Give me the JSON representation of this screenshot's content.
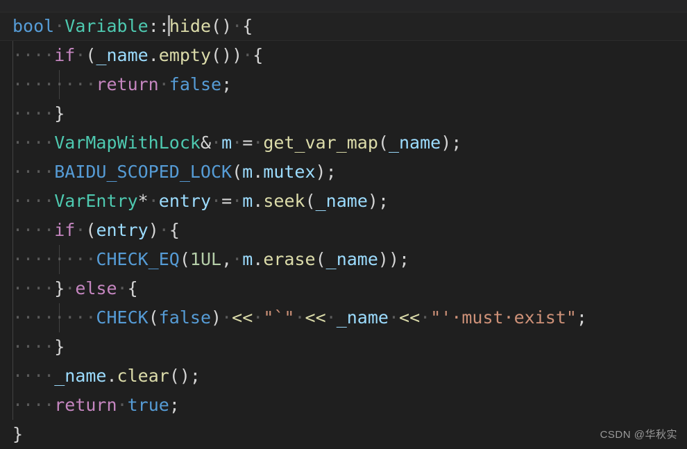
{
  "editor": {
    "language": "cpp",
    "theme": "dark-plus",
    "colors": {
      "background": "#1f1f1f",
      "active_line": "#222222",
      "foreground": "#d4d4d4",
      "keyword": "#569cd6",
      "control": "#c586c0",
      "type": "#4ec9b0",
      "function": "#dcdcaa",
      "variable": "#9cdcfe",
      "number": "#b5cea8",
      "string": "#ce9178",
      "indent_guide": "#606060",
      "whitespace_dot": "#5a5a5a",
      "cursor": "#a8a8a8"
    },
    "cursor": {
      "line": 1,
      "after_text": "bool Variable::"
    }
  },
  "code": {
    "lines": [
      {
        "active": true,
        "guides": 0,
        "tokens": [
          {
            "text": "bool",
            "cls": "t-keyword"
          },
          {
            "text": "·",
            "cls": "ws"
          },
          {
            "text": "Variable",
            "cls": "t-type"
          },
          {
            "text": "::",
            "cls": "t-operator"
          },
          {
            "text": "",
            "cls": "cursor-marker"
          },
          {
            "text": "hide",
            "cls": "t-func"
          },
          {
            "text": "()",
            "cls": "t-punct"
          },
          {
            "text": "·",
            "cls": "ws"
          },
          {
            "text": "{",
            "cls": "t-punct"
          }
        ]
      },
      {
        "active": false,
        "guides": 1,
        "tokens": [
          {
            "text": "····",
            "cls": "ws"
          },
          {
            "text": "if",
            "cls": "t-control"
          },
          {
            "text": "·",
            "cls": "ws"
          },
          {
            "text": "(",
            "cls": "t-punct"
          },
          {
            "text": "_name",
            "cls": "t-var"
          },
          {
            "text": ".",
            "cls": "t-operator"
          },
          {
            "text": "empty",
            "cls": "t-func"
          },
          {
            "text": "())",
            "cls": "t-punct"
          },
          {
            "text": "·",
            "cls": "ws"
          },
          {
            "text": "{",
            "cls": "t-punct"
          }
        ]
      },
      {
        "active": false,
        "guides": 2,
        "tokens": [
          {
            "text": "········",
            "cls": "ws"
          },
          {
            "text": "return",
            "cls": "t-control"
          },
          {
            "text": "·",
            "cls": "ws"
          },
          {
            "text": "false",
            "cls": "t-const"
          },
          {
            "text": ";",
            "cls": "t-operator"
          }
        ]
      },
      {
        "active": false,
        "guides": 1,
        "tokens": [
          {
            "text": "····",
            "cls": "ws"
          },
          {
            "text": "}",
            "cls": "t-punct"
          }
        ]
      },
      {
        "active": false,
        "guides": 1,
        "tokens": [
          {
            "text": "····",
            "cls": "ws"
          },
          {
            "text": "VarMapWithLock",
            "cls": "t-type"
          },
          {
            "text": "&",
            "cls": "t-operator"
          },
          {
            "text": "·",
            "cls": "ws"
          },
          {
            "text": "m",
            "cls": "t-var"
          },
          {
            "text": "·",
            "cls": "ws"
          },
          {
            "text": "=",
            "cls": "t-operator"
          },
          {
            "text": "·",
            "cls": "ws"
          },
          {
            "text": "get_var_map",
            "cls": "t-func"
          },
          {
            "text": "(",
            "cls": "t-punct"
          },
          {
            "text": "_name",
            "cls": "t-var"
          },
          {
            "text": ")",
            "cls": "t-punct"
          },
          {
            "text": ";",
            "cls": "t-operator"
          }
        ]
      },
      {
        "active": false,
        "guides": 1,
        "tokens": [
          {
            "text": "····",
            "cls": "ws"
          },
          {
            "text": "BAIDU_SCOPED_LOCK",
            "cls": "t-macro"
          },
          {
            "text": "(",
            "cls": "t-punct"
          },
          {
            "text": "m",
            "cls": "t-var"
          },
          {
            "text": ".",
            "cls": "t-operator"
          },
          {
            "text": "mutex",
            "cls": "t-var"
          },
          {
            "text": ")",
            "cls": "t-punct"
          },
          {
            "text": ";",
            "cls": "t-operator"
          }
        ]
      },
      {
        "active": false,
        "guides": 1,
        "tokens": [
          {
            "text": "····",
            "cls": "ws"
          },
          {
            "text": "VarEntry",
            "cls": "t-type"
          },
          {
            "text": "*",
            "cls": "t-operator"
          },
          {
            "text": "·",
            "cls": "ws"
          },
          {
            "text": "entry",
            "cls": "t-var"
          },
          {
            "text": "·",
            "cls": "ws"
          },
          {
            "text": "=",
            "cls": "t-operator"
          },
          {
            "text": "·",
            "cls": "ws"
          },
          {
            "text": "m",
            "cls": "t-var"
          },
          {
            "text": ".",
            "cls": "t-operator"
          },
          {
            "text": "seek",
            "cls": "t-func"
          },
          {
            "text": "(",
            "cls": "t-punct"
          },
          {
            "text": "_name",
            "cls": "t-var"
          },
          {
            "text": ")",
            "cls": "t-punct"
          },
          {
            "text": ";",
            "cls": "t-operator"
          }
        ]
      },
      {
        "active": false,
        "guides": 1,
        "tokens": [
          {
            "text": "····",
            "cls": "ws"
          },
          {
            "text": "if",
            "cls": "t-control"
          },
          {
            "text": "·",
            "cls": "ws"
          },
          {
            "text": "(",
            "cls": "t-punct"
          },
          {
            "text": "entry",
            "cls": "t-var"
          },
          {
            "text": ")",
            "cls": "t-punct"
          },
          {
            "text": "·",
            "cls": "ws"
          },
          {
            "text": "{",
            "cls": "t-punct"
          }
        ]
      },
      {
        "active": false,
        "guides": 2,
        "tokens": [
          {
            "text": "········",
            "cls": "ws"
          },
          {
            "text": "CHECK_EQ",
            "cls": "t-macro"
          },
          {
            "text": "(",
            "cls": "t-punct"
          },
          {
            "text": "1UL",
            "cls": "t-number"
          },
          {
            "text": ",",
            "cls": "t-operator"
          },
          {
            "text": "·",
            "cls": "ws"
          },
          {
            "text": "m",
            "cls": "t-var"
          },
          {
            "text": ".",
            "cls": "t-operator"
          },
          {
            "text": "erase",
            "cls": "t-func"
          },
          {
            "text": "(",
            "cls": "t-punct"
          },
          {
            "text": "_name",
            "cls": "t-var"
          },
          {
            "text": "))",
            "cls": "t-punct"
          },
          {
            "text": ";",
            "cls": "t-operator"
          }
        ]
      },
      {
        "active": false,
        "guides": 1,
        "tokens": [
          {
            "text": "····",
            "cls": "ws"
          },
          {
            "text": "}",
            "cls": "t-punct"
          },
          {
            "text": "·",
            "cls": "ws"
          },
          {
            "text": "else",
            "cls": "t-control"
          },
          {
            "text": "·",
            "cls": "ws"
          },
          {
            "text": "{",
            "cls": "t-punct"
          }
        ]
      },
      {
        "active": false,
        "guides": 2,
        "tokens": [
          {
            "text": "········",
            "cls": "ws"
          },
          {
            "text": "CHECK",
            "cls": "t-macro"
          },
          {
            "text": "(",
            "cls": "t-punct"
          },
          {
            "text": "false",
            "cls": "t-const"
          },
          {
            "text": ")",
            "cls": "t-punct"
          },
          {
            "text": "·",
            "cls": "ws"
          },
          {
            "text": "<<",
            "cls": "t-shift"
          },
          {
            "text": "·",
            "cls": "ws"
          },
          {
            "text": "\"`\"",
            "cls": "t-string"
          },
          {
            "text": "·",
            "cls": "ws"
          },
          {
            "text": "<<",
            "cls": "t-shift"
          },
          {
            "text": "·",
            "cls": "ws"
          },
          {
            "text": "_name",
            "cls": "t-var"
          },
          {
            "text": "·",
            "cls": "ws"
          },
          {
            "text": "<<",
            "cls": "t-shift"
          },
          {
            "text": "·",
            "cls": "ws"
          },
          {
            "text": "\"'·must·exist\"",
            "cls": "t-string"
          },
          {
            "text": ";",
            "cls": "t-operator"
          }
        ]
      },
      {
        "active": false,
        "guides": 1,
        "tokens": [
          {
            "text": "····",
            "cls": "ws"
          },
          {
            "text": "}",
            "cls": "t-punct"
          }
        ]
      },
      {
        "active": false,
        "guides": 1,
        "tokens": [
          {
            "text": "····",
            "cls": "ws"
          },
          {
            "text": "_name",
            "cls": "t-var"
          },
          {
            "text": ".",
            "cls": "t-operator"
          },
          {
            "text": "clear",
            "cls": "t-func"
          },
          {
            "text": "()",
            "cls": "t-punct"
          },
          {
            "text": ";",
            "cls": "t-operator"
          }
        ]
      },
      {
        "active": false,
        "guides": 1,
        "tokens": [
          {
            "text": "····",
            "cls": "ws"
          },
          {
            "text": "return",
            "cls": "t-control"
          },
          {
            "text": "·",
            "cls": "ws"
          },
          {
            "text": "true",
            "cls": "t-const"
          },
          {
            "text": ";",
            "cls": "t-operator"
          }
        ]
      },
      {
        "active": false,
        "guides": 0,
        "tokens": [
          {
            "text": "}",
            "cls": "t-punct"
          }
        ]
      }
    ]
  },
  "watermark": {
    "text": "CSDN @华秋实"
  }
}
